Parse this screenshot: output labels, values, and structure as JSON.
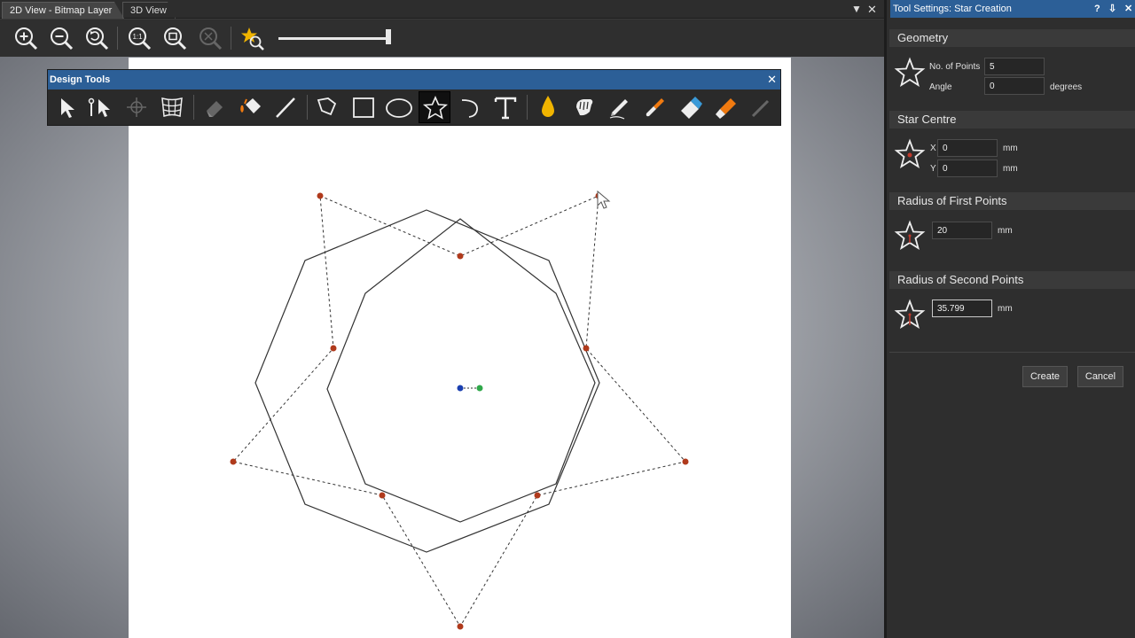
{
  "tabs": {
    "view_2d": "2D View - Bitmap Layer",
    "view_3d": "3D View",
    "dropdown_glyph": "▼",
    "close_glyph": "✕"
  },
  "view_toolbar": {
    "icons": [
      "zoom-in-icon",
      "zoom-out-icon",
      "zoom-previous-icon",
      "zoom-actual-size-icon",
      "zoom-fit-icon",
      "zoom-selection-icon",
      "view-favourite-icon"
    ],
    "zoom_slider_level": 1.0
  },
  "design_tools": {
    "title": "Design Tools",
    "close_glyph": "✕",
    "tools": [
      "select-arrow-icon",
      "node-edit-icon",
      "transform-icon",
      "grid-warp-icon",
      "eraser-fill-icon",
      "paint-bucket-icon",
      "line-icon",
      "polyline-icon",
      "rectangle-icon",
      "ellipse-icon",
      "star-icon",
      "arc-icon",
      "text-icon",
      "drop-icon",
      "smudge-icon",
      "pencil-icon",
      "brush-icon",
      "eraser-icon",
      "highlighter-icon",
      "spray-icon"
    ],
    "active_tool": "star-icon"
  },
  "panel": {
    "title": "Tool Settings: Star Creation",
    "title_controls": [
      "?",
      "⇩",
      "✕"
    ],
    "geometry": {
      "header": "Geometry",
      "points_label": "No. of Points",
      "points_value": "5",
      "angle_label": "Angle",
      "angle_value": "0",
      "angle_unit": "degrees"
    },
    "centre": {
      "header": "Star Centre",
      "x_label": "X",
      "x_value": "0",
      "x_unit": "mm",
      "y_label": "Y",
      "y_value": "0",
      "y_unit": "mm"
    },
    "radius_first": {
      "header": "Radius of First Points",
      "value": "20",
      "unit": "mm"
    },
    "radius_second": {
      "header": "Radius of Second Points",
      "value": "35.799",
      "unit": "mm"
    },
    "create_label": "Create",
    "cancel_label": "Cancel"
  },
  "colors": {
    "accent_blue": "#2c5f97",
    "handle_point": "#b03a1c",
    "centre_blue": "#1a3fb0",
    "centre_green": "#2fa84a",
    "tool_yellow": "#f0b400",
    "tool_orange": "#f07a10"
  }
}
